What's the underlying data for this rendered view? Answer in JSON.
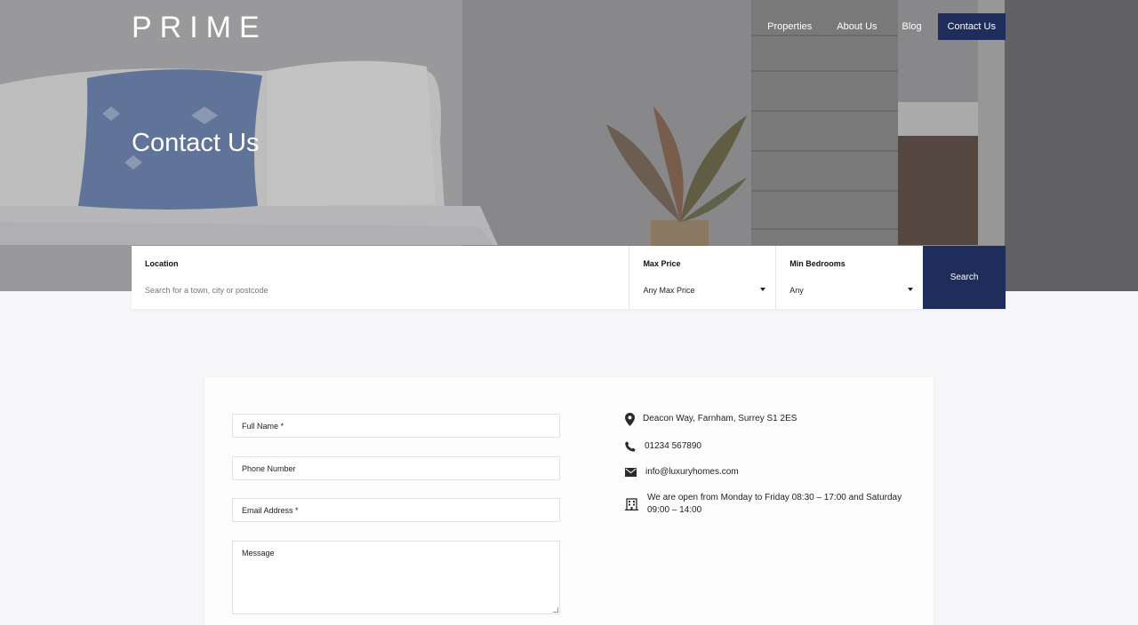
{
  "header": {
    "logo": "PRIME",
    "nav": [
      "Properties",
      "About Us",
      "Blog",
      "Contact Us"
    ],
    "active_nav": "Contact Us"
  },
  "hero": {
    "title": "Contact Us"
  },
  "search": {
    "location_label": "Location",
    "location_placeholder": "Search for a town, city or postcode",
    "max_price_label": "Max Price",
    "max_price_value": "Any Max Price",
    "min_bedrooms_label": "Min Bedrooms",
    "min_bedrooms_value": "Any",
    "button_label": "Search"
  },
  "form": {
    "full_name": "Full Name *",
    "phone": "Phone Number",
    "email": "Email Address *",
    "message": "Message"
  },
  "contact": {
    "address": "Deacon Way, Farnham, Surrey S1 2ES",
    "phone": "01234 567890",
    "email": "info@luxuryhomes.com",
    "hours_line1": "We are open from Monday to Friday 08:30 – 17:00 and Saturday",
    "hours_line2": "09:00 – 14:00"
  },
  "colors": {
    "accent": "#1f2d5c",
    "page_bg": "#f6f5f8"
  },
  "icons": [
    "location-pin-icon",
    "phone-icon",
    "envelope-icon",
    "building-icon",
    "dropdown-caret-icon"
  ]
}
